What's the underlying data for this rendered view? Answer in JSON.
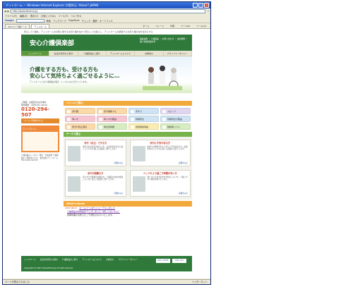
{
  "window": {
    "title": "アットホーム — Windows Internet Explorer が提供元: Yahoo!! JAPAN"
  },
  "address": {
    "url": "http://www.athome.jp/",
    "go_label": "→"
  },
  "menu": [
    "ファイル(F)",
    "編集(E)",
    "表示(V)",
    "お気に入り(A)",
    "ツール(T)",
    "ヘルプ(H)"
  ],
  "google_toolbar": {
    "label": "Google",
    "items": [
      "検索",
      "ブックマーク",
      "PageRank",
      "チェック",
      "翻訳",
      "オートフィル"
    ]
  },
  "tabs": {
    "items": [
      "Yahoo!! 介護ツール",
      "アットホーム"
    ],
    "right": [
      "ホーム",
      "フィード",
      "印刷",
      "ページ(P)",
      "ツール(O)"
    ]
  },
  "lead_text": "安心して介護を。アットホームのお客に関する北京介護を住かで安心してお過ごし、アットホームの顧客する北京介護の住を住まるする",
  "site": {
    "logo": "安心介護倶楽部",
    "header_links": "職員採用 ｜ 介護用品 ｜ お問い合わせ ｜ 会社概要 ｜ 個人情報保護方針",
    "nav": [
      "トップページ",
      "生活の状況から探す",
      "介護用品のご紹介",
      "アットホームについて",
      "お問合せ",
      "プライバシーポリシー"
    ],
    "hero_title": "介護をする方も、受ける方も\n安心して気持ちよく過ごせるように…",
    "hero_sub": "アットホームでは介護用品の販売・レンタルなどを行っています。"
  },
  "sidebar": {
    "phone_label": "ご相談・お問合せはお気軽に",
    "phone_hours": "受付時間：平日9:00〜18:00",
    "phone": "0120-294-507",
    "mail_button": "メールで問合せする",
    "banner_title": "アットホーム",
    "info": "介護用品のレンタル・販売・住宅改修 介護保険のご相談承ります。 株式会社アットホーム TEL:0120-294-507"
  },
  "genre": {
    "heading": "ジャンルで選ぶ",
    "items": [
      {
        "label": "歩行器",
        "color": "g-orange"
      },
      {
        "label": "歩行補助つえ",
        "color": "g-orange"
      },
      {
        "label": "手すり",
        "color": "g-blue"
      },
      {
        "label": "スロープ",
        "color": "g-purple"
      },
      {
        "label": "車いす",
        "color": "g-pink"
      },
      {
        "label": "車いす付属品",
        "color": "g-pink"
      },
      {
        "label": "特殊寝台",
        "color": "g-blue"
      },
      {
        "label": "特殊寝台付属品",
        "color": "g-blue"
      },
      {
        "label": "床ずれ防止用具",
        "color": "g-orange"
      },
      {
        "label": "体位変換器",
        "color": "g-green"
      },
      {
        "label": "排泄関連用品",
        "color": "g-yellow"
      },
      {
        "label": "移動用リフト",
        "color": "g-green"
      }
    ]
  },
  "cases": {
    "heading": "ケースで選ぶ",
    "items": [
      {
        "title": "歩行（自立）できる方",
        "body": "歩行の自立度を高めたい方、日常生活を安全に過ごしたい方に適した商品をご紹介します。",
        "more": "詳細をみる"
      },
      {
        "title": "歩行に不安のある方",
        "body": "屋内での移動や立ち上がりに不安がある方、転倒を防止したい方に適した商品をご紹介します。",
        "more": "詳細をみる"
      },
      {
        "title": "歩行が困難な方",
        "body": "車いすでの移動が必要な方、介護者の負担を軽減したい方に適した商品をご紹介します。",
        "more": "詳細をみる"
      },
      {
        "title": "ベッドの上で過ごす時間が多い方",
        "body": "寝たきりの方や床ずれを防止したい方、介護しやすい環境を整えたい方に。",
        "more": "詳細をみる"
      }
    ]
  },
  "news": {
    "heading": "What's News",
    "items": [
      {
        "date": "2007.08.02",
        "text": "ホームページがリニューアルしました"
      },
      {
        "date": "",
        "text": "介護用品の新商品をアップしました（詳しくはこちら）"
      },
      {
        "date": "",
        "text": "夏季休業のお知らせ ご不便をおかけいたします。"
      }
    ]
  },
  "footer": {
    "links": [
      "トップページ",
      "生活の状況から探す",
      "介護用品のご紹介",
      "アットホームについて",
      "お問合せ",
      "プライバシーポリシー"
    ],
    "badges": [
      "W3C XHTML",
      "W3C CSS"
    ],
    "copyright": "Copyright (C) 2007 www.athome.jp All right reserved."
  },
  "status": {
    "left": "ページが表示されました",
    "right": "インターネット"
  }
}
